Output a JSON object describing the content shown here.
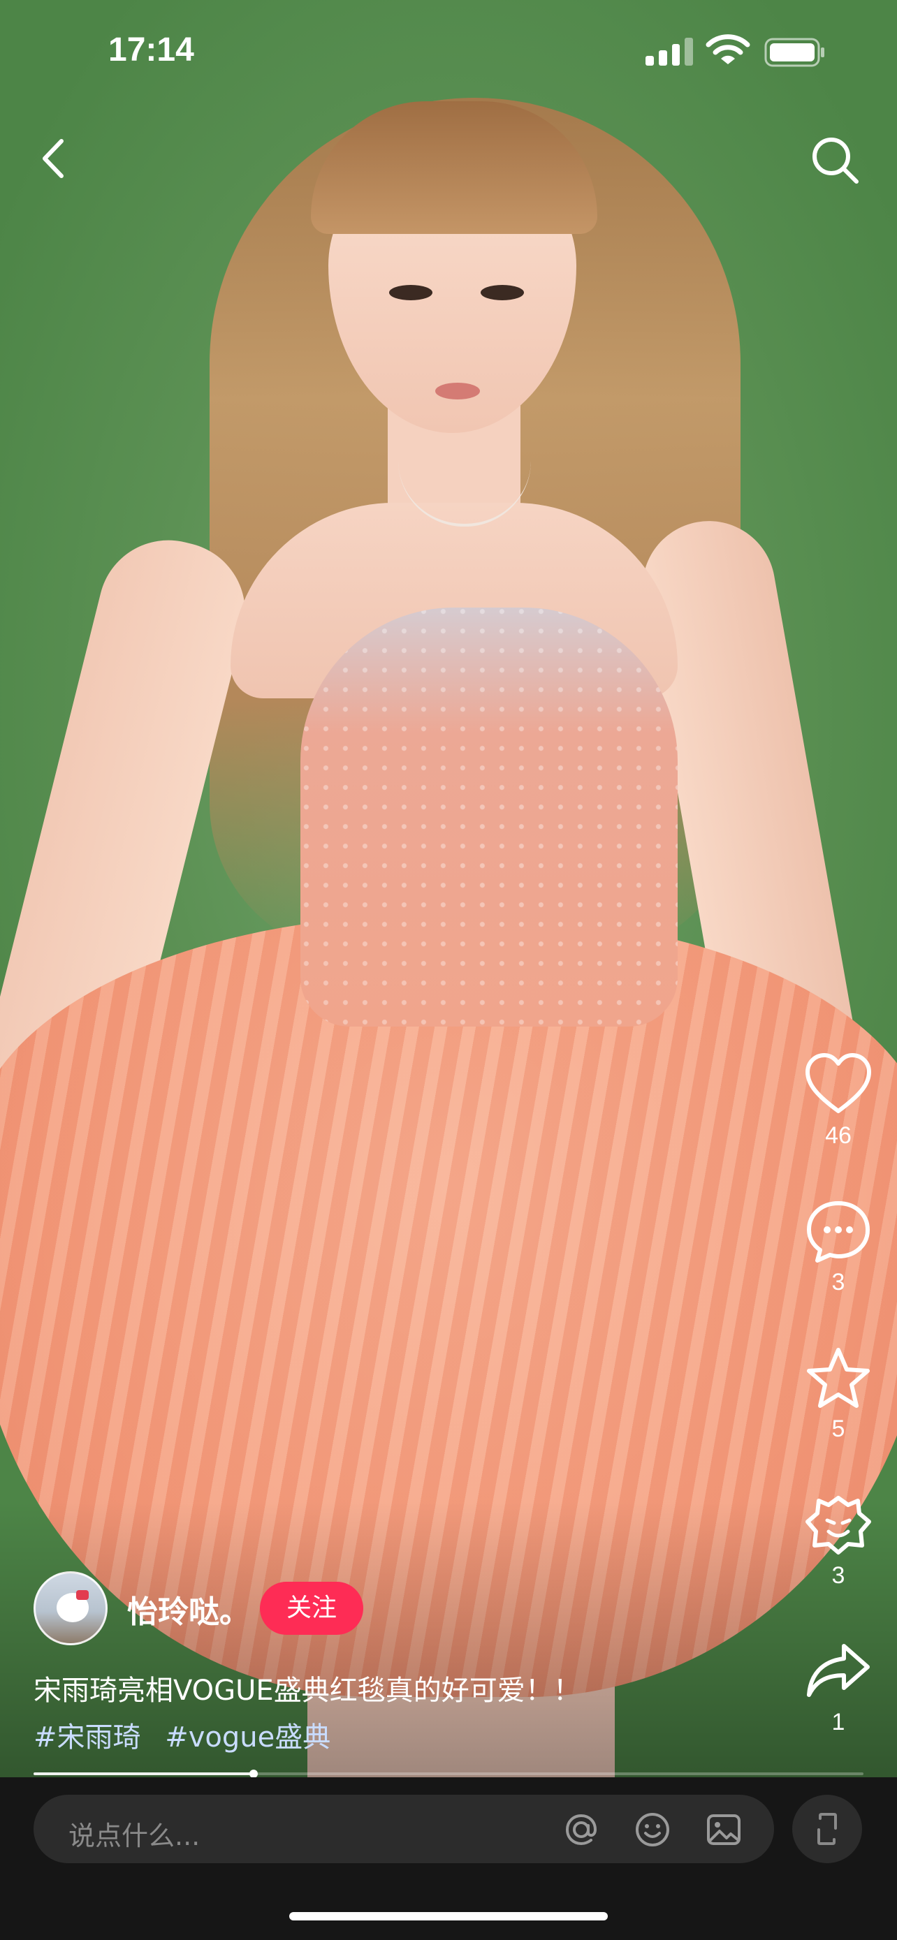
{
  "status_bar": {
    "time": "17:14"
  },
  "author": {
    "name": "怡玲哒。",
    "follow_label": "关注"
  },
  "caption": {
    "text": "宋雨琦亮相VOGUE盛典红毯真的好可爱！！",
    "tags": [
      "#宋雨琦",
      "#vogue盛典"
    ]
  },
  "actions": {
    "likes": "46",
    "comments": "3",
    "favorites": "5",
    "emoji_reactions": "3",
    "shares": "1"
  },
  "progress": {
    "played_fraction": 0.265
  },
  "comment_bar": {
    "placeholder": "说点什么..."
  },
  "colors": {
    "follow_button": "#fe2c55",
    "tag_text": "#c9dcff",
    "bottom_bar": "#161616"
  },
  "icons": [
    "chevron-left-icon",
    "search-icon",
    "heart-icon",
    "comment-icon",
    "star-icon",
    "emoji-reaction-icon",
    "share-icon",
    "at-icon",
    "emoji-icon",
    "image-icon",
    "expand-icon"
  ]
}
